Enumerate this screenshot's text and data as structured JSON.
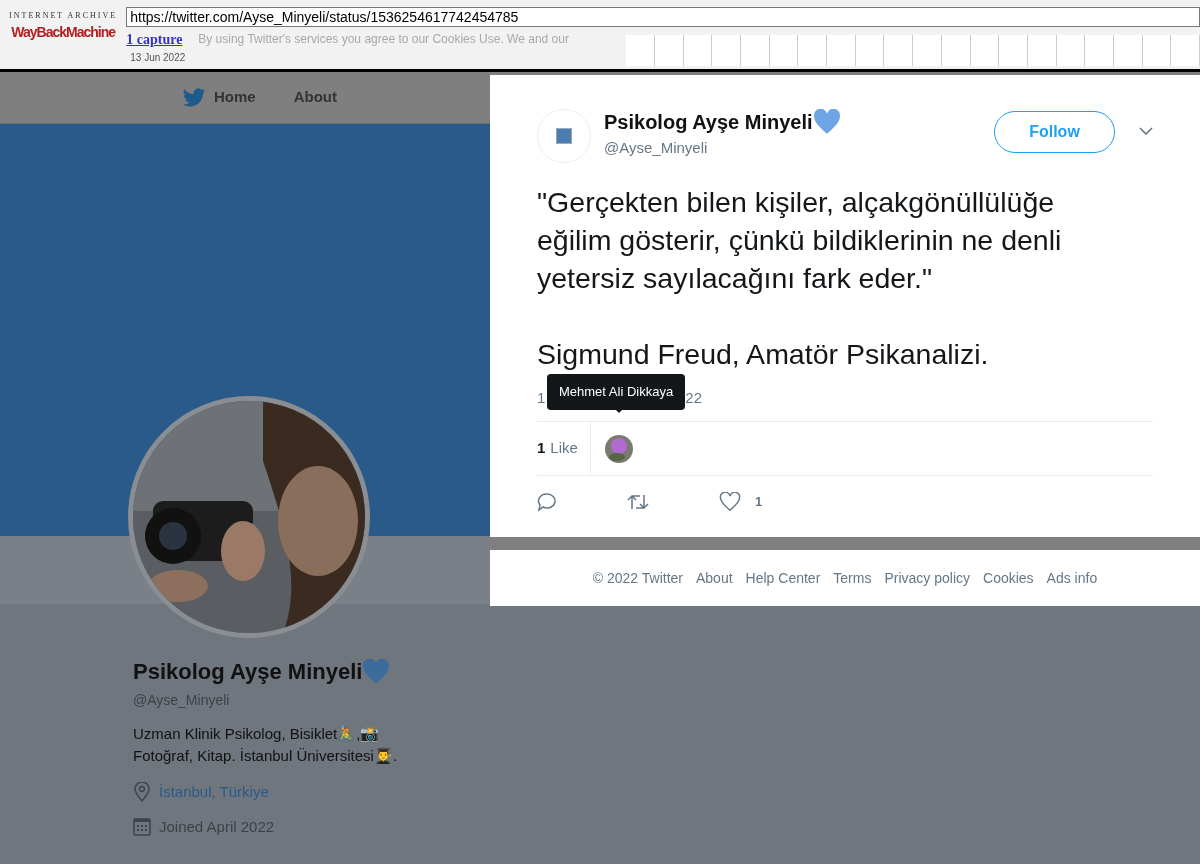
{
  "wayback": {
    "logo_top": "INTERNET ARCHIVE",
    "logo_main": "WayBackMachine",
    "url": "https://twitter.com/Ayse_Minyeli/status/1536254617742454785",
    "captures": "1 capture",
    "date": "13 Jun 2022"
  },
  "cookie_notice": "By using Twitter's services you agree to our Cookies Use. We and our",
  "nav": [
    {
      "label": "Home"
    },
    {
      "label": "About"
    }
  ],
  "profile": {
    "name": "Psikolog Ayşe Minyeli",
    "handle": "@Ayse_Minyeli",
    "bio": [
      "Uzman Klinik Psikolog, Bisiklet🚴,📸",
      "Fotoğraf, Kitap. İstanbul Üniversitesi👨‍🎓."
    ],
    "location": "İstanbul, Türkiye",
    "joined": "Joined April 2022"
  },
  "tweet": {
    "name": "Psikolog Ayşe Minyeli",
    "handle": "@Ayse_Minyeli",
    "follow": "Follow",
    "text": [
      "\"Gerçekten bilen kişiler, alçakgönüllülüğe eğilim gösterir, çünkü bildiklerinin ne denli yetersiz sayılacağını fark eder.\"",
      "Sigmund Freud, Amatör Psikanalizi."
    ],
    "timestamp_start": "1",
    "timestamp_end": "22",
    "tooltip": "Mehmet Ali Dikkaya",
    "likes_count": "1",
    "likes_label": "Like",
    "heart_count": "1"
  },
  "footer": [
    "© 2022 Twitter",
    "About",
    "Help Center",
    "Terms",
    "Privacy policy",
    "Cookies",
    "Ads info"
  ]
}
